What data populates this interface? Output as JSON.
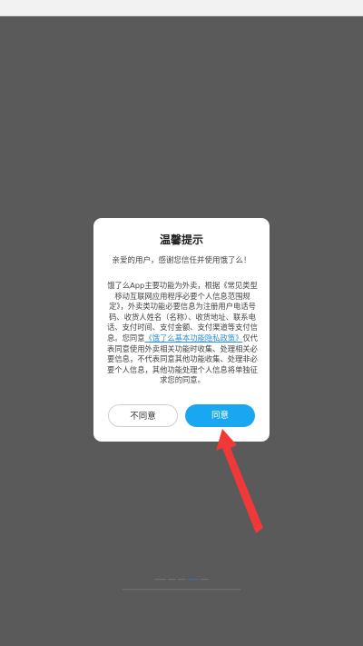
{
  "dialog": {
    "title": "温馨提示",
    "greeting": "亲爱的用户，感谢您信任并使用饿了么！",
    "body_part1": "饿了么App主要功能为外卖，根据《常见类型移动互联网应用程序必要个人信息范围规定》，外卖类功能必要信息为注册用户电话号码、收货人姓名（名称）、收货地址、联系电话、支付时间、支付金额、支付渠道等支付信息。您同意",
    "policy_link": "《饿了么基本功能隐私政策》",
    "body_part2": "仅代表同意使用外卖相关功能时收集、处理相关必要信息，不代表同意其他功能收集、处理非必要个人信息，其他功能处理个人信息将单独征求您的同意。",
    "disagree_label": "不同意",
    "agree_label": "同意"
  },
  "colors": {
    "overlay": "#5a5a5a",
    "agree_button": "#19a7f2",
    "link": "#2a8fd6",
    "annotation_arrow": "#f03838"
  }
}
